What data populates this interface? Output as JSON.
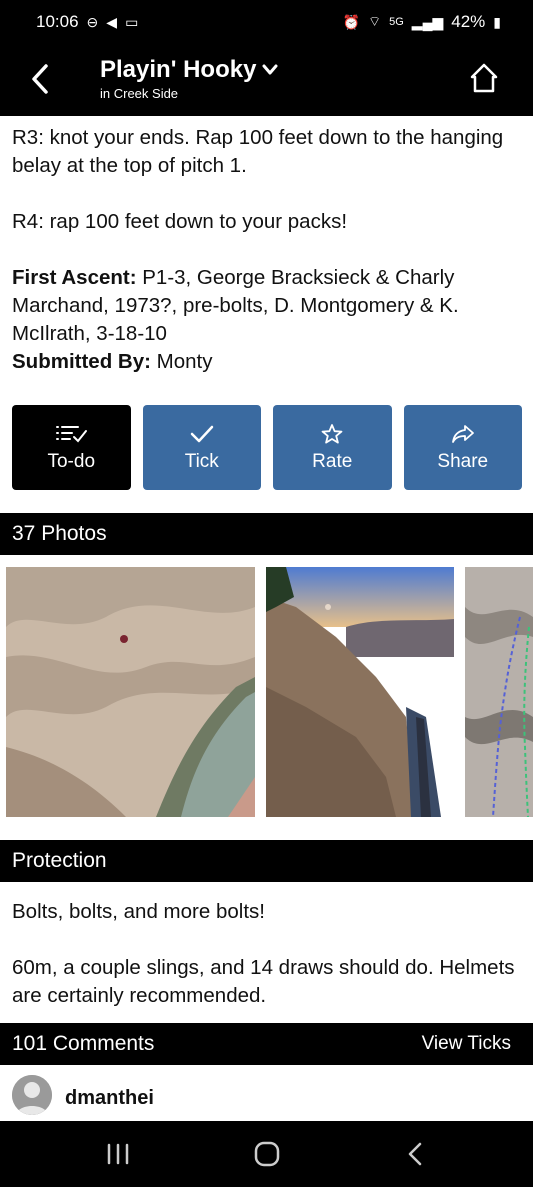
{
  "status_bar": {
    "time": "10:06",
    "battery": "42%",
    "network": "5G"
  },
  "app_bar": {
    "title": "Playin' Hooky",
    "subtitle": "in Creek Side"
  },
  "description": {
    "r3": "R3: knot your ends. Rap 100 feet down to the hanging belay at the top of pitch 1.",
    "r4": "R4: rap 100 feet down to your packs!",
    "first_ascent_label": "First Ascent:",
    "first_ascent_value": " P1-3, George Bracksieck & Charly Marchand, 1973?, pre-bolts, D. Montgomery & K. McIlrath, 3-18-10",
    "submitted_by_label": "Submitted By:",
    "submitted_by_value": " Monty"
  },
  "actions": {
    "todo_label": "To-do",
    "tick_label": "Tick",
    "rate_label": "Rate",
    "share_label": "Share"
  },
  "photos": {
    "header": "37 Photos"
  },
  "protection": {
    "header": "Protection",
    "line1": "Bolts, bolts, and more bolts!",
    "line2": "60m, a couple slings, and 14 draws should do. Helmets are certainly recommended."
  },
  "comments": {
    "header": "101 Comments",
    "view_ticks": "View Ticks",
    "first_author": "dmanthei"
  },
  "colors": {
    "action_blue": "#3a6aa0",
    "bar_black": "#000000"
  }
}
